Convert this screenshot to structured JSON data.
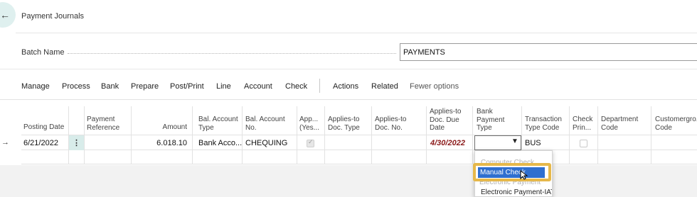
{
  "header": {
    "back_icon": "arrow-left-icon",
    "title": "Payment Journals"
  },
  "batch": {
    "label": "Batch Name",
    "value": "PAYMENTS"
  },
  "actions": {
    "items": [
      "Manage",
      "Process",
      "Bank",
      "Prepare",
      "Post/Print",
      "Line",
      "Account",
      "Check"
    ],
    "secondary": [
      "Actions",
      "Related"
    ],
    "fewer_options": "Fewer options"
  },
  "columns": [
    {
      "l1": "",
      "l2": "Posting Date"
    },
    {
      "l1": "Payment",
      "l2": "Reference"
    },
    {
      "l1": "",
      "l2": "Amount"
    },
    {
      "l1": "Bal. Account",
      "l2": "Type"
    },
    {
      "l1": "Bal. Account",
      "l2": "No."
    },
    {
      "l1": "App...",
      "l2": "(Yes..."
    },
    {
      "l1": "Applies-to",
      "l2": "Doc. Type"
    },
    {
      "l1": "Applies-to",
      "l2": "Doc. No."
    },
    {
      "l1": "Applies-to",
      "l2": "Doc. Due",
      "l3": "Date"
    },
    {
      "l1": "Bank",
      "l2": "Payment",
      "l3": "Type"
    },
    {
      "l1": "Transaction",
      "l2": "Type Code"
    },
    {
      "l1": "Check",
      "l2": "Prin..."
    },
    {
      "l1": "Department",
      "l2": "Code"
    },
    {
      "l1": "Customergro...",
      "l2": "Code"
    }
  ],
  "row": {
    "posting_date": "6/21/2022",
    "amount": "6.018.10",
    "bal_account_type": "Bank Acco...",
    "bal_account_no": "CHEQUING",
    "applies_to_due_date": "4/30/2022",
    "transaction_type_code": "BUS",
    "row_menu_icon": "vertical-ellipsis-icon",
    "select_chevron_icon": "chevron-down-icon"
  },
  "dropdown": {
    "options": [
      "Computer Check",
      "Manual Check",
      "Electronic Payment",
      "Electronic Payment-IAT"
    ],
    "selected": "Manual Check"
  },
  "colors": {
    "accent_teal": "#d8ecea",
    "selection_blue": "#2f6fcf",
    "highlight_gold": "#e6b84a",
    "due_date_red": "#8b1a1a"
  }
}
